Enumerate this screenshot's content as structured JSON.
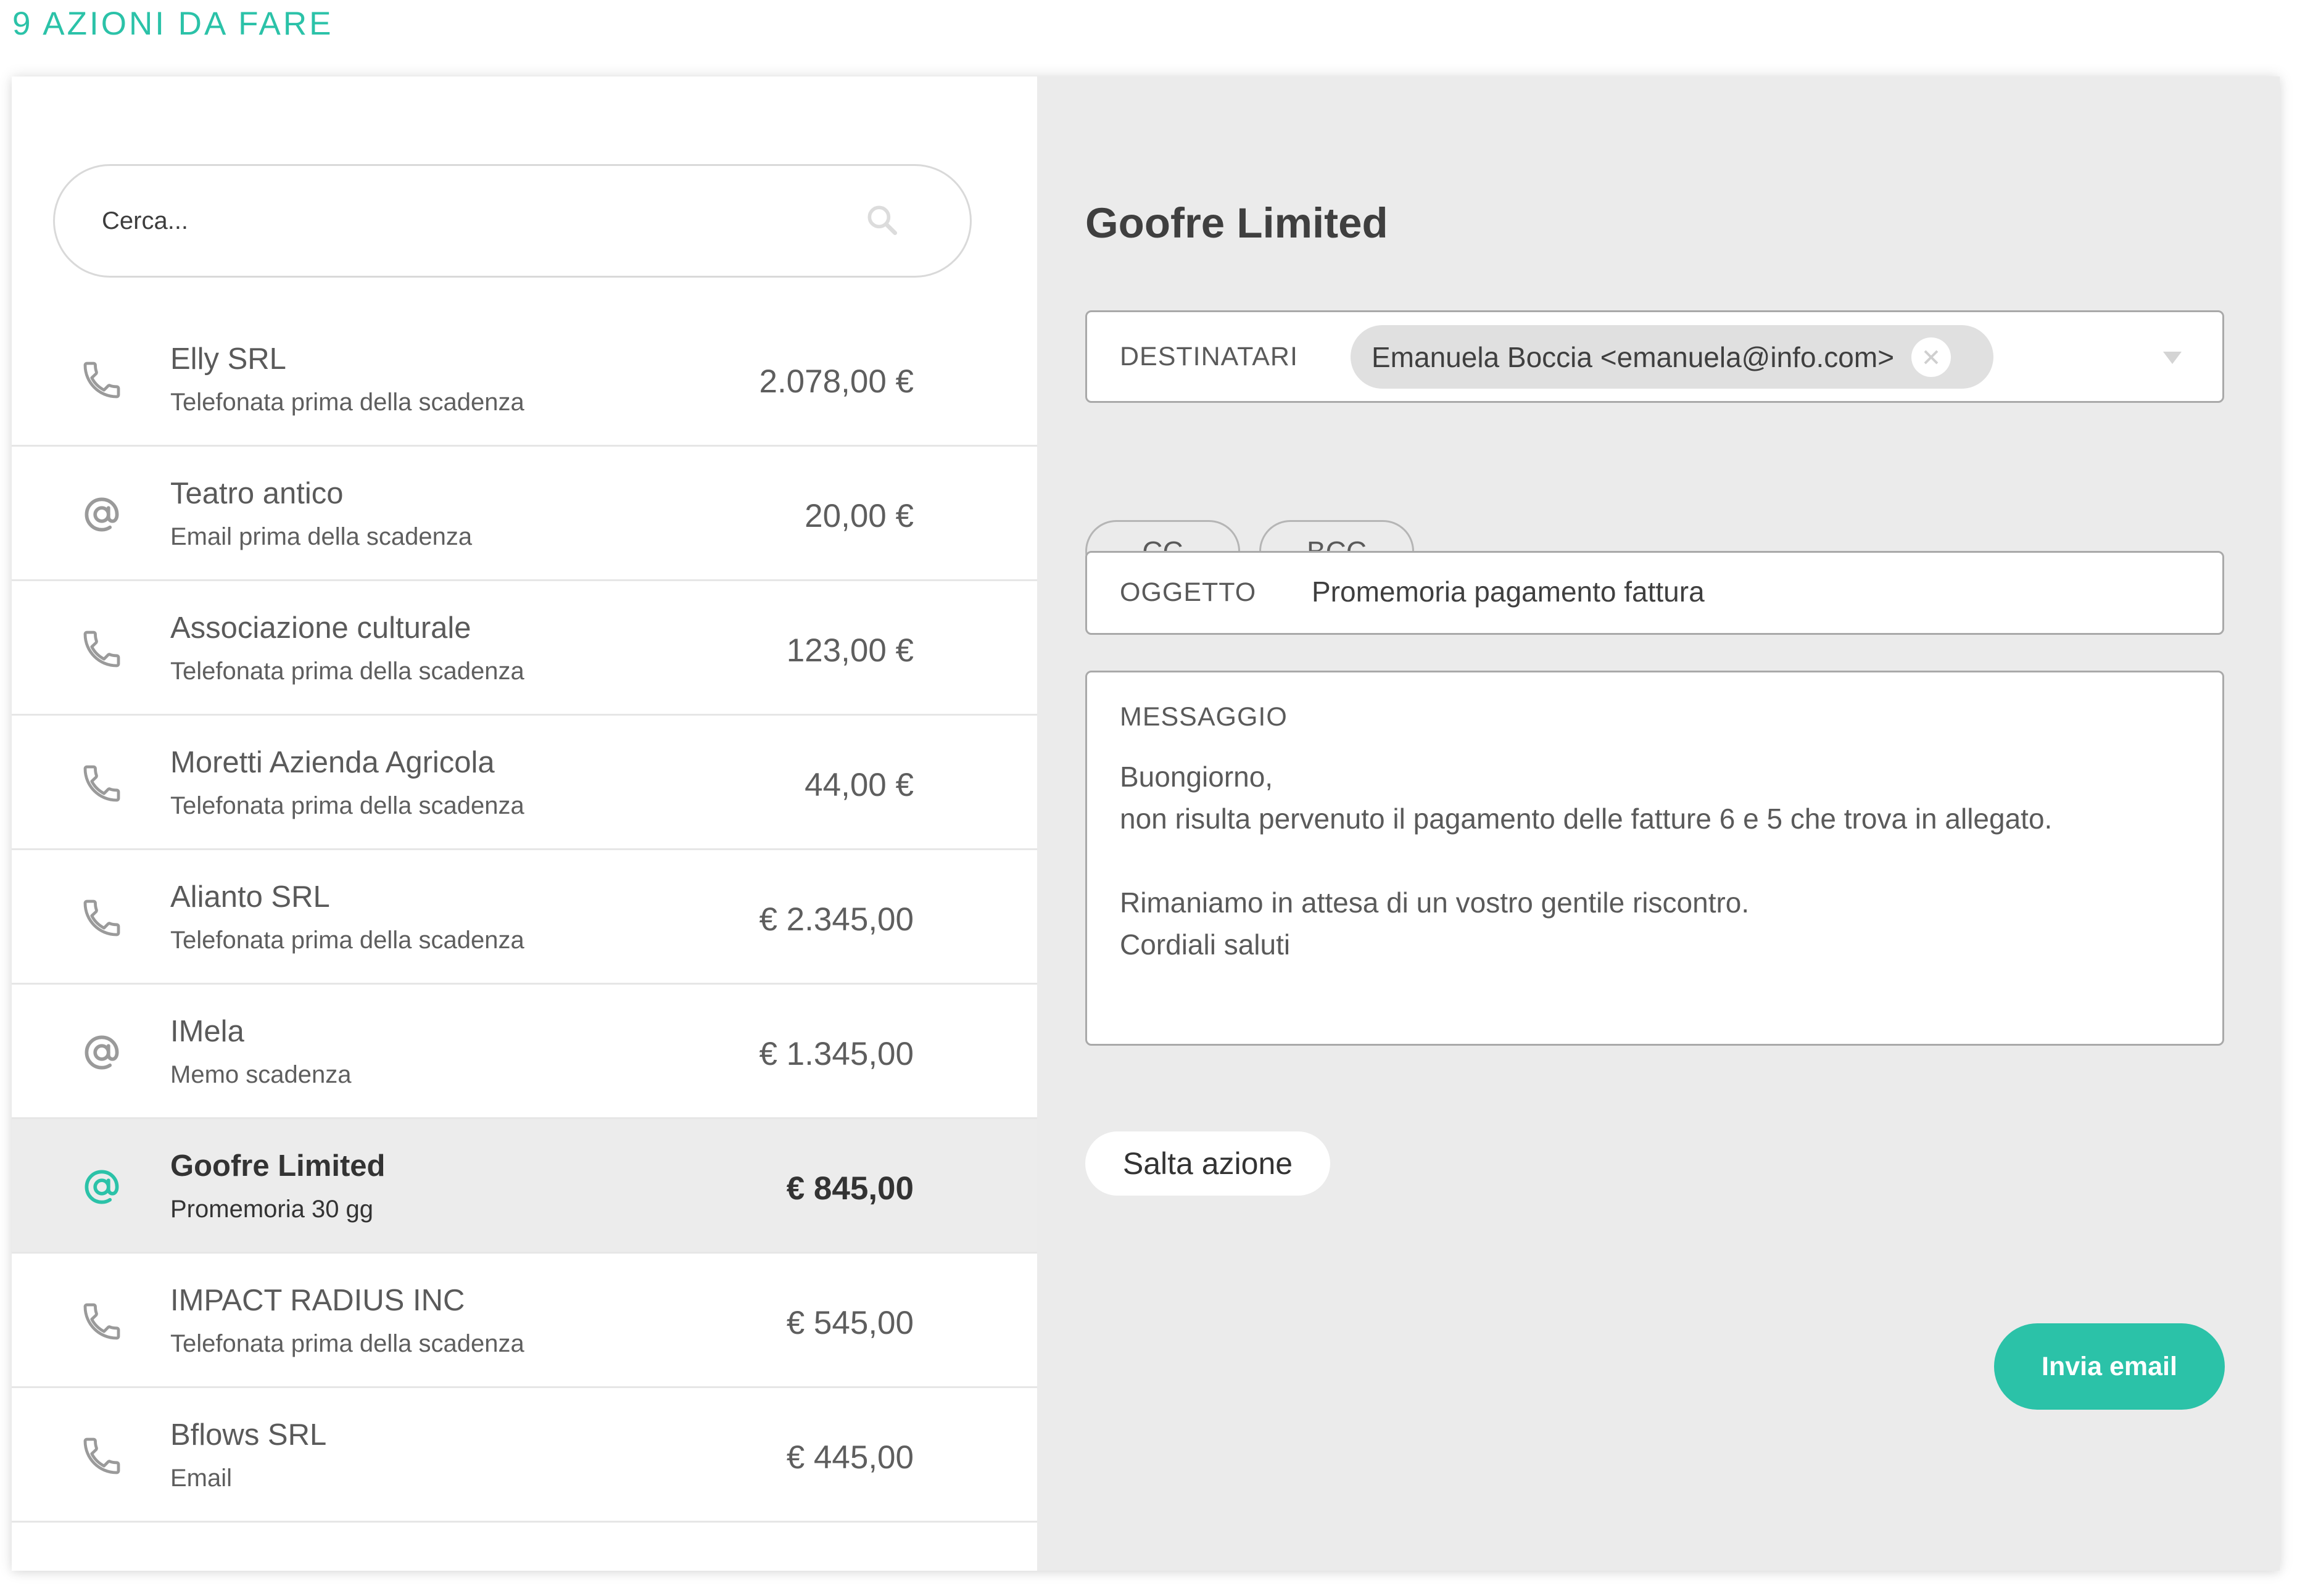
{
  "header": {
    "title": "9 AZIONI DA FARE"
  },
  "search": {
    "placeholder": "Cerca..."
  },
  "actions": [
    {
      "name": "Elly SRL",
      "subtitle": "Telefonata prima della scadenza",
      "amount": "2.078,00 €",
      "icon": "phone-icon",
      "selected": false
    },
    {
      "name": "Teatro antico",
      "subtitle": "Email prima della scadenza",
      "amount": "20,00 €",
      "icon": "at-icon",
      "selected": false
    },
    {
      "name": "Associazione culturale",
      "subtitle": "Telefonata prima della scadenza",
      "amount": "123,00 €",
      "icon": "phone-icon",
      "selected": false
    },
    {
      "name": "Moretti Azienda Agricola",
      "subtitle": "Telefonata prima della scadenza",
      "amount": "44,00 €",
      "icon": "phone-icon",
      "selected": false
    },
    {
      "name": "Alianto SRL",
      "subtitle": "Telefonata prima della scadenza",
      "amount": "€ 2.345,00",
      "icon": "phone-icon",
      "selected": false
    },
    {
      "name": "IMela",
      "subtitle": "Memo scadenza",
      "amount": "€ 1.345,00",
      "icon": "at-icon",
      "selected": false
    },
    {
      "name": "Goofre Limited",
      "subtitle": "Promemoria 30 gg",
      "amount": "€ 845,00",
      "icon": "at-icon",
      "selected": true
    },
    {
      "name": "IMPACT RADIUS INC",
      "subtitle": "Telefonata prima della scadenza",
      "amount": "€ 545,00",
      "icon": "phone-icon",
      "selected": false
    },
    {
      "name": "Bflows SRL",
      "subtitle": "Email",
      "amount": "€ 445,00",
      "icon": "phone-icon",
      "selected": false
    }
  ],
  "detail": {
    "title": "Goofre Limited",
    "recipients_label": "DESTINATARI",
    "recipient": "Emanuela Boccia <emanuela@info.com>",
    "cc_label": "CC",
    "bcc_label": "BCC",
    "subject_label": "OGGETTO",
    "subject": "Promemoria pagamento fattura",
    "message_label": "MESSAGGIO",
    "message_lines": [
      "Buongiorno,",
      "non risulta pervenuto il pagamento delle fatture 6 e 5 che trova in allegato.",
      "",
      "Rimaniamo in attesa di un vostro gentile riscontro.",
      "Cordiali saluti"
    ],
    "skip_label": "Salta azione",
    "send_label": "Invia email"
  },
  "colors": {
    "accent": "#2bc2a8",
    "icon_default": "#9a9a9a",
    "selected_row": "#ececec",
    "right_panel_bg": "#ebebeb"
  }
}
